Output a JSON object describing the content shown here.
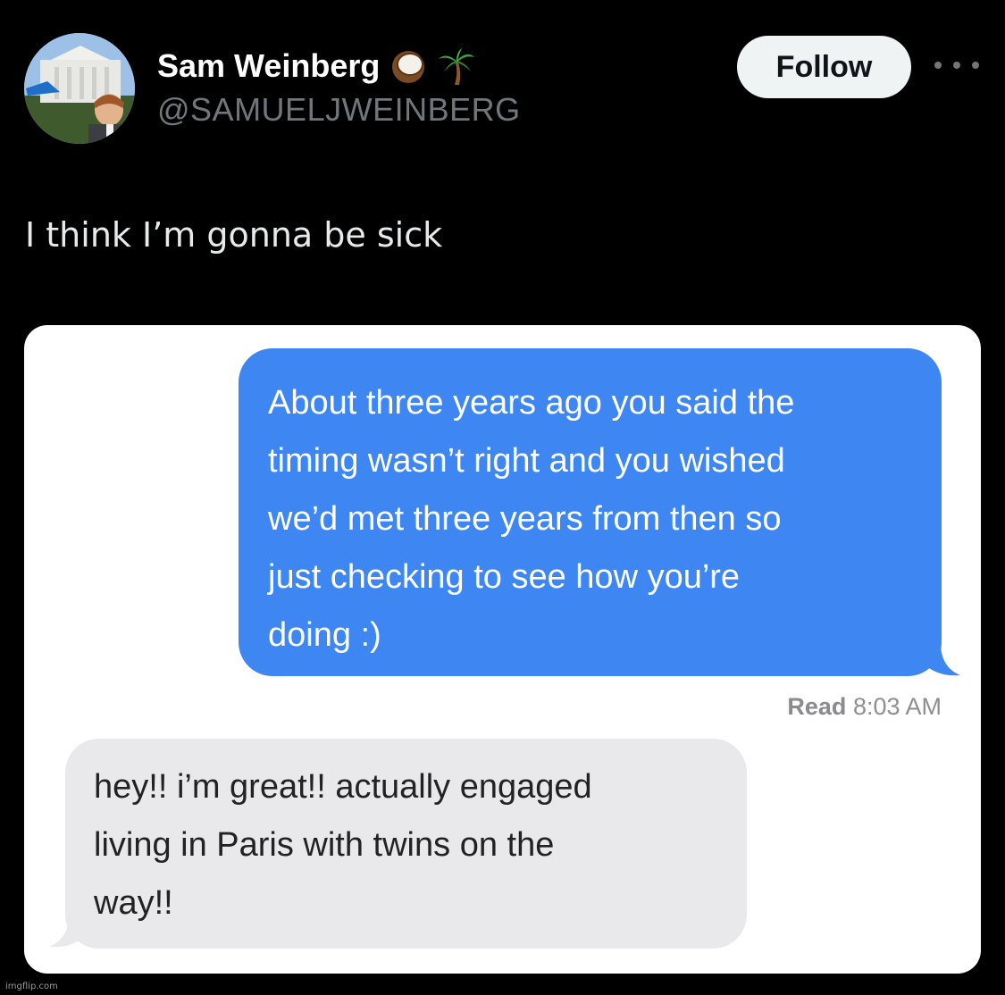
{
  "tweet": {
    "author": {
      "display_name": "Sam Weinberg",
      "name_emojis": [
        "coconut-icon",
        "palm-tree-icon"
      ],
      "handle": "@SAMUELJWEINBERG",
      "avatar": "avatar-photo"
    },
    "follow_label": "Follow",
    "more_icon": "more-options-icon",
    "text": "I think I’m gonna be sick"
  },
  "media": {
    "sent_message": {
      "lines": [
        "About three years ago you said the",
        "timing wasn’t right and you wished",
        "we’d met three years from then so",
        "just checking to see how you’re",
        "doing :)"
      ],
      "color": "#3e87f2"
    },
    "read_receipt": {
      "label": "Read",
      "time": "8:03 AM"
    },
    "received_message": {
      "lines": [
        "hey!! i’m great!! actually engaged",
        "living in Paris with twins on the",
        "way!!"
      ],
      "color": "#e9e9eb"
    }
  },
  "watermark": "imgflip.com",
  "colors": {
    "background": "#000000",
    "handle_gray": "#71767b",
    "follow_bg": "#eff3f4"
  }
}
